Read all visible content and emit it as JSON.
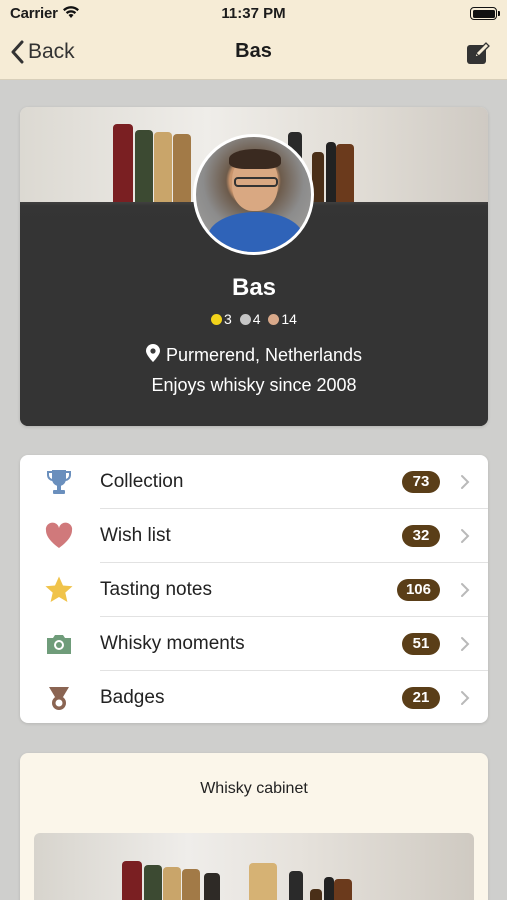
{
  "status_bar": {
    "carrier": "Carrier",
    "time": "11:37 PM"
  },
  "nav": {
    "back_label": "Back",
    "title": "Bas",
    "edit_icon": "edit-icon"
  },
  "profile": {
    "name": "Bas",
    "medals": [
      {
        "color": "#f2d31a",
        "count": "3"
      },
      {
        "color": "#c6c6c6",
        "count": "4"
      },
      {
        "color": "#d9a98a",
        "count": "14"
      }
    ],
    "location": "Purmerend, Netherlands",
    "since": "Enjoys whisky since 2008"
  },
  "menu": [
    {
      "label": "Collection",
      "count": "73",
      "icon": "trophy-icon"
    },
    {
      "label": "Wish list",
      "count": "32",
      "icon": "heart-icon"
    },
    {
      "label": "Tasting notes",
      "count": "106",
      "icon": "star-icon"
    },
    {
      "label": "Whisky moments",
      "count": "51",
      "icon": "camera-icon"
    },
    {
      "label": "Badges",
      "count": "21",
      "icon": "badge-icon"
    }
  ],
  "cabinet": {
    "title": "Whisky cabinet"
  },
  "colors": {
    "nav_bg": "#f6ecd6",
    "badge_bg": "#5a3e18",
    "page_bg": "#cfcfcd"
  }
}
